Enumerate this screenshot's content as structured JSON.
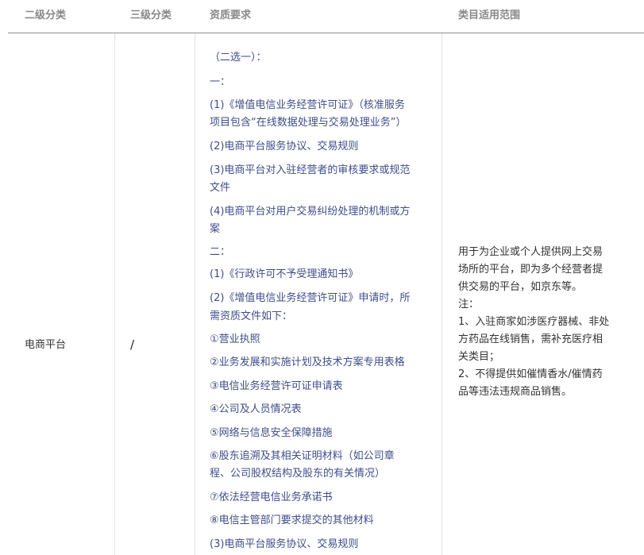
{
  "headers": {
    "col1": "二级分类",
    "col2": "三级分类",
    "col3": "资质要求",
    "col4": "类目适用范围"
  },
  "row": {
    "category2": "电商平台",
    "category3": "/",
    "requirements": [
      "（二选一）：",
      "一：",
      "(1)《增值电信业务经营许可证》（核准服务",
      "项目包含“在线数据处理与交易处理业务”）",
      "(2)电商平台服务协议、交易规则",
      "(3)电商平台对入驻经营者的审核要求或规范",
      "文件",
      "(4)电商平台对用户交易纠纷处理的机制或方",
      "案",
      "二：",
      "(1)《行政许可不予受理通知书》",
      "(2)《增值电信业务经营许可证》申请时，所",
      "需资质文件如下：",
      "①营业执照",
      "②业务发展和实施计划及技术方案专用表格",
      "③电信业务经营许可证申请表",
      "④公司及人员情况表",
      "⑤网络与信息安全保障措施",
      "⑥股东追溯及其相关证明材料（如公司章",
      "程、公司股权结构及股东的有关情况）",
      "⑦依法经营电信业务承诺书",
      "⑧电信主管部门要求提交的其他材料",
      "(3)电商平台服务协议、交易规则"
    ],
    "scope": [
      "用于为企业或个人提供网上交易",
      "场所的平台，即为多个经营者提",
      "供交易的平台，如京东等。",
      "注：",
      "1、入驻商家如涉医疗器械、非处",
      "方药品在线销售，需补充医疗相",
      "关类目；",
      "2、不得提供如催情香水/催情药",
      "品等违法违规商品销售。"
    ]
  }
}
